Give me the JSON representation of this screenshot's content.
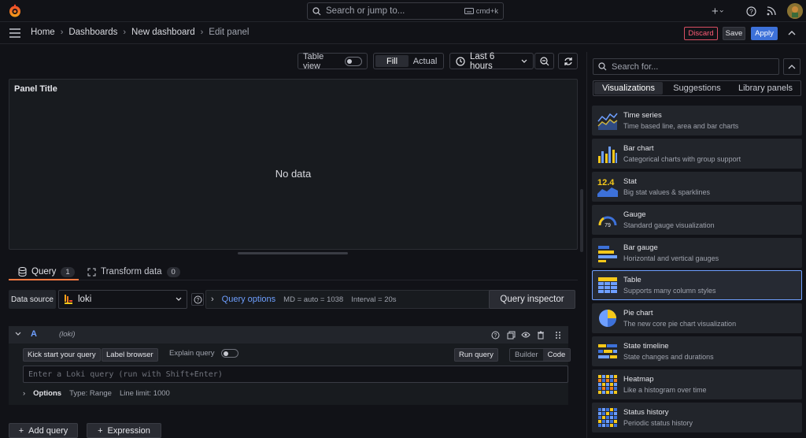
{
  "topbar": {
    "search_placeholder": "Search or jump to...",
    "search_shortcut": "cmd+k"
  },
  "breadcrumb": [
    "Home",
    "Dashboards",
    "New dashboard",
    "Edit panel"
  ],
  "actions": {
    "discard": "Discard",
    "save": "Save",
    "apply": "Apply"
  },
  "toolbar": {
    "table_view": "Table view",
    "fill": "Fill",
    "actual": "Actual",
    "time_range": "Last 6 hours"
  },
  "panel": {
    "title": "Panel Title",
    "empty_text": "No data"
  },
  "query_tabs": {
    "query_label": "Query",
    "query_count": "1",
    "transform_label": "Transform data",
    "transform_count": "0"
  },
  "datasource": {
    "label": "Data source",
    "selected": "loki",
    "query_options_label": "Query options",
    "md": "MD = auto = 1038",
    "interval": "Interval = 20s",
    "inspector": "Query inspector"
  },
  "query_row": {
    "ref_id": "A",
    "datasource_name": "(loki)",
    "kick_start": "Kick start your query",
    "label_browser": "Label browser",
    "explain_query": "Explain query",
    "run_query": "Run query",
    "builder": "Builder",
    "code": "Code",
    "input_placeholder": "Enter a Loki query (run with Shift+Enter)",
    "options_label": "Options",
    "options_type": "Type: Range",
    "options_limit": "Line limit: 1000"
  },
  "bottom": {
    "add_query": "Add query",
    "expression": "Expression"
  },
  "sidebar": {
    "search_placeholder": "Search for...",
    "tabs": [
      "Visualizations",
      "Suggestions",
      "Library panels"
    ],
    "items": [
      {
        "title": "Time series",
        "desc": "Time based line, area and bar charts",
        "icon": "time-series-icon"
      },
      {
        "title": "Bar chart",
        "desc": "Categorical charts with group support",
        "icon": "bar-chart-icon"
      },
      {
        "title": "Stat",
        "desc": "Big stat values & sparklines",
        "icon": "stat-icon"
      },
      {
        "title": "Gauge",
        "desc": "Standard gauge visualization",
        "icon": "gauge-icon"
      },
      {
        "title": "Bar gauge",
        "desc": "Horizontal and vertical gauges",
        "icon": "bar-gauge-icon"
      },
      {
        "title": "Table",
        "desc": "Supports many column styles",
        "icon": "table-icon"
      },
      {
        "title": "Pie chart",
        "desc": "The new core pie chart visualization",
        "icon": "pie-chart-icon"
      },
      {
        "title": "State timeline",
        "desc": "State changes and durations",
        "icon": "state-timeline-icon"
      },
      {
        "title": "Heatmap",
        "desc": "Like a histogram over time",
        "icon": "heatmap-icon"
      },
      {
        "title": "Status history",
        "desc": "Periodic status history",
        "icon": "status-history-icon"
      }
    ],
    "stat_value": "12.4",
    "gauge_value": "79"
  },
  "colors": {
    "accent": "#3d71d9",
    "link": "#6e9fff",
    "tab_underline": "#ff7b43",
    "danger": "#ff5c77"
  }
}
